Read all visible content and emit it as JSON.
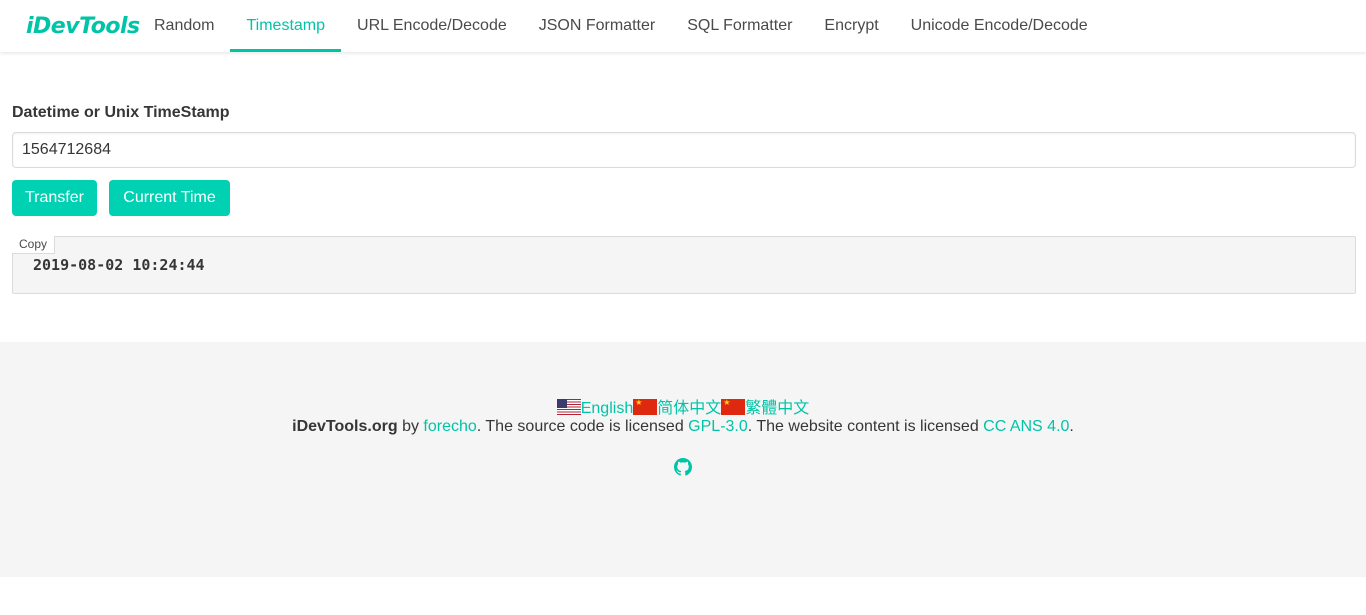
{
  "brand": {
    "name": "iDevTools"
  },
  "nav": {
    "items": [
      {
        "label": "Random"
      },
      {
        "label": "Timestamp"
      },
      {
        "label": "URL Encode/Decode"
      },
      {
        "label": "JSON Formatter"
      },
      {
        "label": "SQL Formatter"
      },
      {
        "label": "Encrypt"
      },
      {
        "label": "Unicode Encode/Decode"
      }
    ],
    "active": "Timestamp"
  },
  "form": {
    "label": "Datetime or Unix TimeStamp",
    "input_value": "1564712684",
    "transfer_label": "Transfer",
    "current_time_label": "Current Time"
  },
  "result": {
    "copy_label": "Copy",
    "value": "2019-08-02 10:24:44"
  },
  "footer": {
    "languages": [
      {
        "label": "English",
        "flag": "us-flag-icon"
      },
      {
        "label": "简体中文",
        "flag": "cn-flag-icon"
      },
      {
        "label": "繁體中文",
        "flag": "cn-flag-icon"
      }
    ],
    "site_name": "iDevTools.org",
    "by": " by ",
    "author": "forecho",
    "source_text": ". The source code is licensed ",
    "source_license": "GPL-3.0",
    "content_text": ". The website content is licensed ",
    "content_license": "CC ANS 4.0",
    "end": "."
  },
  "colors": {
    "accent": "#00c4a7",
    "button": "#00d1b2",
    "footer_bg": "#f5f5f5"
  },
  "icons": {
    "github": "github-icon"
  }
}
